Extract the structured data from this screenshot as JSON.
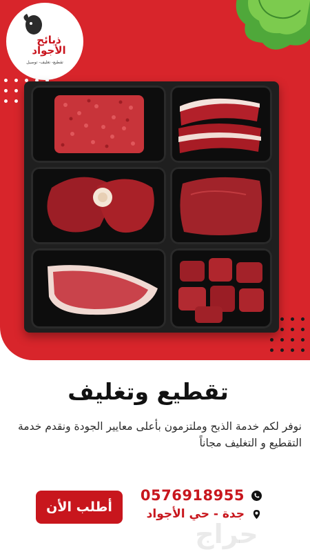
{
  "brand": {
    "name_line1": "ذبائح",
    "name_line2": "الأجواد",
    "tagline": "تقطيع- تغليف- توصيل"
  },
  "headline": "تقطيع وتغليف",
  "description": "نوفر لكم خدمة الذبح وملتزمون بأعلى معايير الجودة ونقدم خدمة التقطيع و التغليف مجاناً",
  "cta": {
    "label": "أطلب الأن"
  },
  "contact": {
    "phone": "0576918955",
    "phone_icon": "phone-icon",
    "location": "جدة - حي الأجواد",
    "location_icon": "location-pin-icon"
  },
  "watermark": "حراج",
  "colors": {
    "brand_red": "#d8252b",
    "accent_red": "#c8161d",
    "text_dark": "#111111"
  }
}
